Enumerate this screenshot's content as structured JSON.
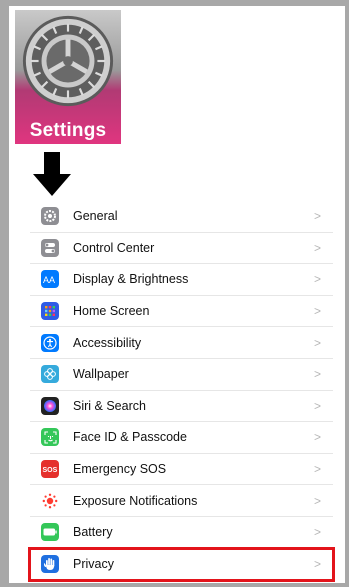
{
  "app_icon": {
    "label": "Settings"
  },
  "settings_list": {
    "items": [
      {
        "label": "General",
        "icon": "gear-icon",
        "color": "#8e8e93"
      },
      {
        "label": "Control Center",
        "icon": "toggles-icon",
        "color": "#8e8e93"
      },
      {
        "label": "Display & Brightness",
        "icon": "text-size-icon",
        "color": "#007aff"
      },
      {
        "label": "Home Screen",
        "icon": "grid-icon",
        "color": "#2f5be5"
      },
      {
        "label": "Accessibility",
        "icon": "accessibility-icon",
        "color": "#007aff"
      },
      {
        "label": "Wallpaper",
        "icon": "flower-icon",
        "color": "#35aadc"
      },
      {
        "label": "Siri & Search",
        "icon": "siri-icon",
        "color": "#222222"
      },
      {
        "label": "Face ID & Passcode",
        "icon": "face-id-icon",
        "color": "#34c759"
      },
      {
        "label": "Emergency SOS",
        "icon": "sos-icon",
        "color": "#e5302c"
      },
      {
        "label": "Exposure Notifications",
        "icon": "exposure-icon",
        "color": "#ffffff"
      },
      {
        "label": "Battery",
        "icon": "battery-icon",
        "color": "#34c759"
      },
      {
        "label": "Privacy",
        "icon": "hand-icon",
        "color": "#1f6fe0"
      }
    ],
    "chevron": ">"
  },
  "highlight_color": "#e3141b"
}
